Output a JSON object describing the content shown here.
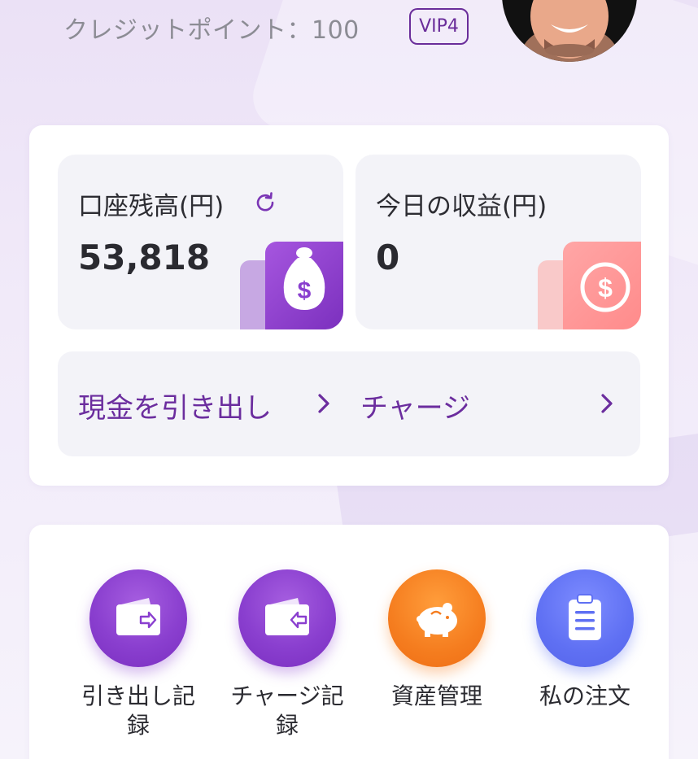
{
  "header": {
    "credit_text": "クレジットポイント：100",
    "vip_badge": "VIP4"
  },
  "balance_card": {
    "account": {
      "label": "口座残高(円)",
      "value": "53,818"
    },
    "today": {
      "label": "今日の収益(円)",
      "value": "0"
    }
  },
  "actions": {
    "withdraw_label": "現金を引き出し",
    "charge_label": "チャージ"
  },
  "menu": [
    {
      "label": "引き出し記\n録",
      "icon": "wallet-out-icon"
    },
    {
      "label": "チャージ記\n録",
      "icon": "wallet-in-icon"
    },
    {
      "label": "資産管理",
      "icon": "piggy-bank-icon"
    },
    {
      "label": "私の注文",
      "icon": "clipboard-icon"
    }
  ],
  "colors": {
    "accent_purple": "#6b2d9e",
    "orange": "#f57d1f",
    "blue": "#5f70f3",
    "coin_pink": "#ff8a8a"
  }
}
